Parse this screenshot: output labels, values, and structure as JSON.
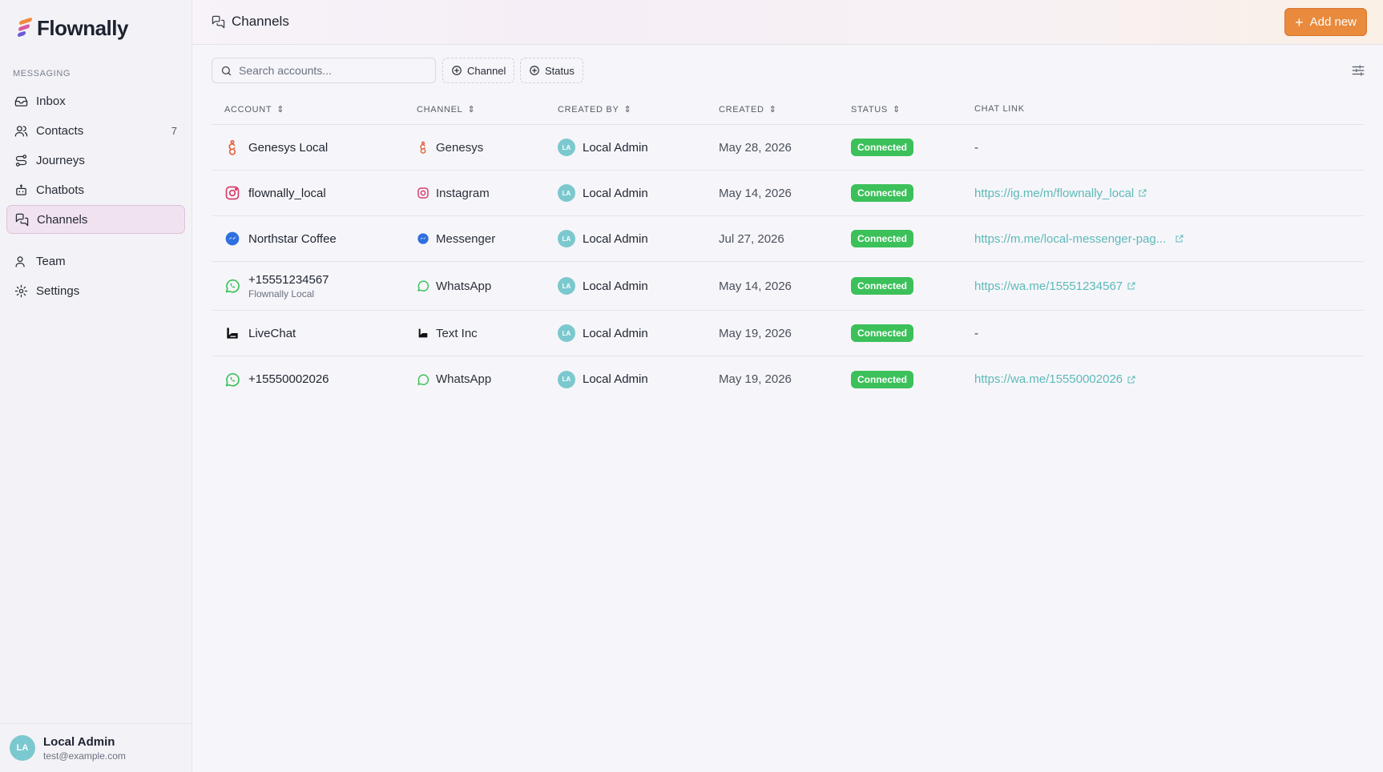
{
  "app": {
    "name": "Flownally"
  },
  "sidebar": {
    "section_label": "MESSAGING",
    "items": [
      {
        "label": "Inbox",
        "icon": "inbox-icon"
      },
      {
        "label": "Contacts",
        "icon": "users-icon",
        "count": "7"
      },
      {
        "label": "Journeys",
        "icon": "route-icon"
      },
      {
        "label": "Chatbots",
        "icon": "bot-icon"
      },
      {
        "label": "Channels",
        "icon": "chat-icon",
        "active": true
      },
      {
        "label": "Team",
        "icon": "team-icon"
      },
      {
        "label": "Settings",
        "icon": "gear-icon"
      }
    ],
    "user": {
      "initials": "LA",
      "name": "Local Admin",
      "email": "test@example.com"
    }
  },
  "header": {
    "title": "Channels",
    "add_label": "Add new"
  },
  "filters": {
    "search_placeholder": "Search accounts...",
    "channel_label": "Channel",
    "status_label": "Status"
  },
  "table": {
    "columns": [
      "ACCOUNT",
      "CHANNEL",
      "CREATED BY",
      "CREATED",
      "STATUS",
      "CHAT LINK"
    ],
    "rows": [
      {
        "account": "Genesys Local",
        "sub": "",
        "channel": "Genesys",
        "icon": "genesys",
        "creator": "Local Admin",
        "initials": "LA",
        "created": "May 28, 2026",
        "status": "Connected",
        "link": "-"
      },
      {
        "account": "flownally_local",
        "sub": "",
        "channel": "Instagram",
        "icon": "instagram",
        "creator": "Local Admin",
        "initials": "LA",
        "created": "May 14, 2026",
        "status": "Connected",
        "link": "https://ig.me/m/flownally_local"
      },
      {
        "account": "Northstar Coffee",
        "sub": "",
        "channel": "Messenger",
        "icon": "messenger",
        "creator": "Local Admin",
        "initials": "LA",
        "created": "Jul 27, 2026",
        "status": "Connected",
        "link": "https://m.me/local-messenger-pag..."
      },
      {
        "account": "+15551234567",
        "sub": "Flownally Local",
        "channel": "WhatsApp",
        "icon": "whatsapp",
        "creator": "Local Admin",
        "initials": "LA",
        "created": "May 14, 2026",
        "status": "Connected",
        "link": "https://wa.me/15551234567"
      },
      {
        "account": "LiveChat",
        "sub": "",
        "channel": "Text Inc",
        "icon": "textinc",
        "creator": "Local Admin",
        "initials": "LA",
        "created": "May 19, 2026",
        "status": "Connected",
        "link": "-"
      },
      {
        "account": "+15550002026",
        "sub": "",
        "channel": "WhatsApp",
        "icon": "whatsapp",
        "creator": "Local Admin",
        "initials": "LA",
        "created": "May 19, 2026",
        "status": "Connected",
        "link": "https://wa.me/15550002026"
      }
    ]
  },
  "colors": {
    "accent": "#e98a3c",
    "active_nav": "#f1e2f0",
    "connected": "#3cc05a",
    "link": "#5db9b8",
    "avatar": "#7cc8cf"
  }
}
